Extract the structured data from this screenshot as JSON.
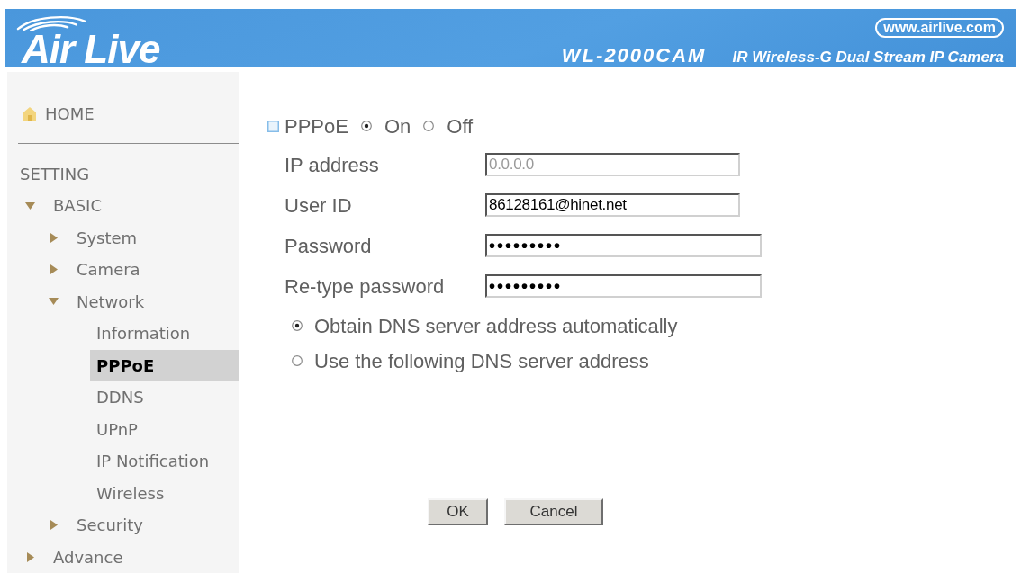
{
  "header": {
    "logo": "Air Live",
    "url": "www.airlive.com",
    "model": "WL-2000CAM",
    "product": "IR Wireless-G Dual Stream IP Camera"
  },
  "sidebar": {
    "home": "HOME",
    "section": "SETTING",
    "items": [
      {
        "label": "BASIC",
        "expanded": true,
        "children": [
          {
            "label": "System",
            "expanded": false
          },
          {
            "label": "Camera",
            "expanded": false
          },
          {
            "label": "Network",
            "expanded": true,
            "children": [
              {
                "label": "Information",
                "selected": false
              },
              {
                "label": "PPPoE",
                "selected": true
              },
              {
                "label": "DDNS",
                "selected": false
              },
              {
                "label": "UPnP",
                "selected": false
              },
              {
                "label": "IP Notification",
                "selected": false
              },
              {
                "label": "Wireless",
                "selected": false
              }
            ]
          },
          {
            "label": "Security",
            "expanded": false
          }
        ]
      },
      {
        "label": "Advance",
        "expanded": false
      }
    ]
  },
  "form": {
    "title": "PPPoE",
    "mode_options": [
      {
        "label": "On",
        "selected": true
      },
      {
        "label": "Off",
        "selected": false
      }
    ],
    "fields": [
      {
        "kind": "text",
        "label": "IP address",
        "value": "0.0.0.0",
        "disabled": true
      },
      {
        "kind": "text",
        "label": "User ID",
        "value": "86128161@hinet.net",
        "disabled": false
      },
      {
        "kind": "password",
        "label": "Password",
        "value": "•••••••••",
        "disabled": false
      },
      {
        "kind": "password",
        "label": "Re-type password",
        "value": "•••••••••",
        "disabled": false
      }
    ],
    "dns_options": [
      {
        "label": "Obtain DNS server address automatically",
        "selected": true
      },
      {
        "label": "Use the following DNS server address",
        "selected": false
      }
    ],
    "buttons": [
      "OK",
      "Cancel"
    ]
  }
}
